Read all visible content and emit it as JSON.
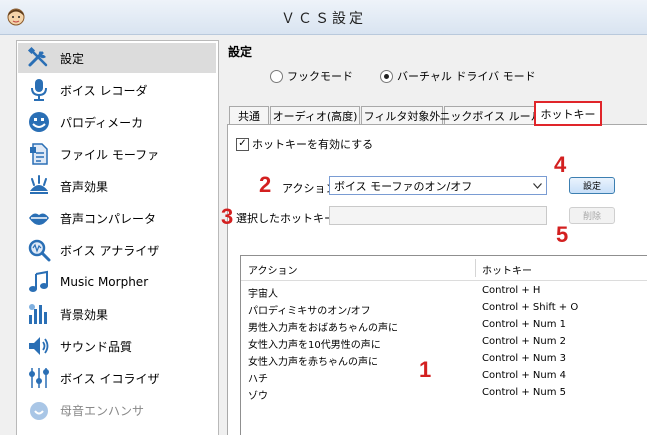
{
  "window": {
    "title": "ＶＣＳ設定"
  },
  "sidebar": {
    "items": [
      {
        "label": "設定",
        "icon": "tools-icon",
        "selected": true
      },
      {
        "label": "ボイス レコーダ",
        "icon": "microphone-icon"
      },
      {
        "label": "パロディメーカ",
        "icon": "face-icon"
      },
      {
        "label": "ファイル モーファ",
        "icon": "file-icon"
      },
      {
        "label": "音声効果",
        "icon": "voice-effect-icon"
      },
      {
        "label": "音声コンパレータ",
        "icon": "lips-icon"
      },
      {
        "label": "ボイス アナライザ",
        "icon": "magnifier-icon"
      },
      {
        "label": "Music Morpher",
        "icon": "music-note-icon"
      },
      {
        "label": "背景効果",
        "icon": "equalizer-icon"
      },
      {
        "label": "サウンド品質",
        "icon": "speaker-icon"
      },
      {
        "label": "ボイス イコライザ",
        "icon": "sliders-icon"
      },
      {
        "label": "母音エンハンサ",
        "icon": "vowel-icon"
      }
    ]
  },
  "main": {
    "section_title": "設定",
    "mode": {
      "options": [
        "フックモード",
        "バーチャル ドライバ モード"
      ],
      "selected": "バーチャル ドライバ モード"
    },
    "tabs": [
      {
        "label": "共通"
      },
      {
        "label": "オーディオ(高度)"
      },
      {
        "label": "フィルタ対象外"
      },
      {
        "label": "ニックボイス ルール"
      },
      {
        "label": "ホットキー",
        "active": true
      }
    ],
    "hotkey": {
      "enable_label": "ホットキーを有効にする",
      "enable_checked": true,
      "action_label": "アクション",
      "action_value": "ボイス モーファのオン/オフ",
      "selected_hotkey_label": "選択したホットキー",
      "selected_hotkey_value": "",
      "set_button": "設定",
      "delete_button": "削除"
    },
    "list": {
      "columns": [
        "アクション",
        "ホットキー"
      ],
      "rows": [
        {
          "action": "宇宙人",
          "hotkey": "Control + H"
        },
        {
          "action": "パロディミキサのオン/オフ",
          "hotkey": "Control + Shift + O"
        },
        {
          "action": "男性入力声をおばあちゃんの声に",
          "hotkey": "Control + Num 1"
        },
        {
          "action": "女性入力声を10代男性の声に",
          "hotkey": "Control + Num 2"
        },
        {
          "action": "女性入力声を赤ちゃんの声に",
          "hotkey": "Control + Num 3"
        },
        {
          "action": "ハチ",
          "hotkey": "Control + Num 4"
        },
        {
          "action": "ゾウ",
          "hotkey": "Control + Num 5"
        }
      ]
    }
  },
  "annotations": [
    "1",
    "2",
    "3",
    "4",
    "5"
  ],
  "colors": {
    "annotation": "#d32020",
    "tab_highlight": "#e0252a",
    "button_border": "#3c7fb1"
  }
}
